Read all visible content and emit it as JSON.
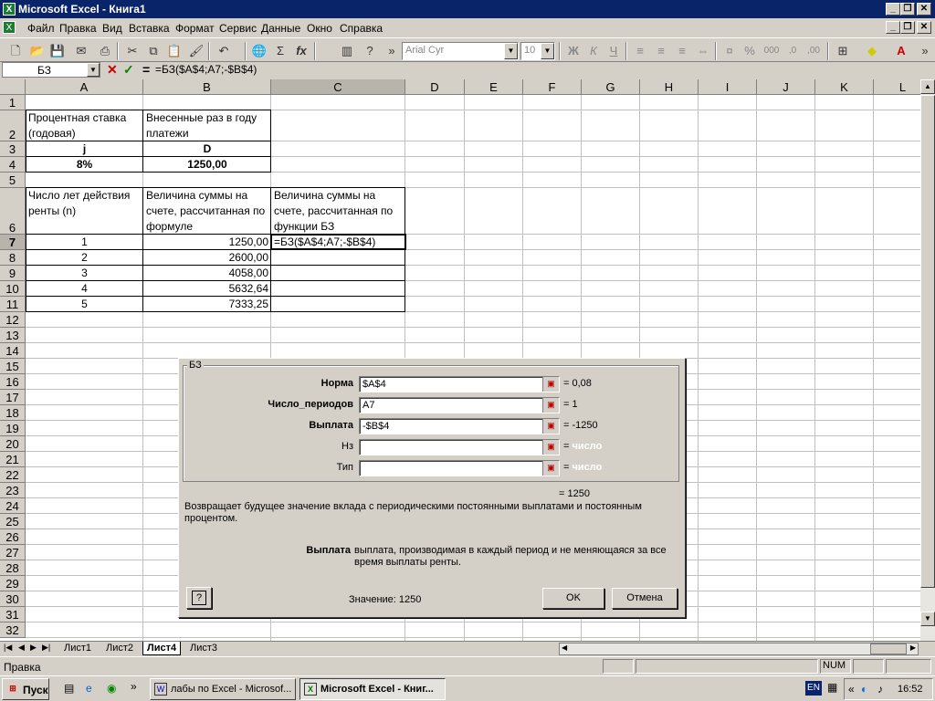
{
  "window": {
    "title": "Microsoft Excel - Книга1",
    "app_icon": "X"
  },
  "menu": [
    "Файл",
    "Правка",
    "Вид",
    "Вставка",
    "Формат",
    "Сервис",
    "Данные",
    "Окно",
    "Справка"
  ],
  "toolbar": {
    "font_name": "Arial Cyr",
    "font_size": "10"
  },
  "formula_bar": {
    "name_box": "БЗ",
    "equals": "=",
    "formula": "=БЗ($A$4;A7;-$B$4)"
  },
  "columns": [
    "A",
    "B",
    "C",
    "D",
    "E",
    "F",
    "G",
    "H",
    "I",
    "J",
    "K",
    "L"
  ],
  "rows": [
    "1",
    "2",
    "3",
    "4",
    "5",
    "6",
    "7",
    "8",
    "9",
    "10",
    "11",
    "12",
    "13",
    "14",
    "15",
    "16",
    "17",
    "18",
    "19",
    "20",
    "21",
    "22",
    "23",
    "24",
    "25",
    "26",
    "27",
    "28",
    "29",
    "30",
    "31",
    "32"
  ],
  "cells": {
    "A2": "Процентная ставка (годовая)",
    "B2": "Внесенные раз в году платежи",
    "A3": "j",
    "B3": "D",
    "A4": "8%",
    "B4": "1250,00",
    "A6": "Число лет действия ренты (n)",
    "B6": "Величина суммы на счете, рассчитанная по формуле",
    "C6": "Величина суммы на счете, рассчитанная по функции БЗ",
    "C7": "=БЗ($A$4;A7;-$B$4)",
    "A7": "1",
    "A8": "2",
    "A9": "3",
    "A10": "4",
    "A11": "5",
    "B7": "1250,00",
    "B8": "2600,00",
    "B9": "4058,00",
    "B10": "5632,64",
    "B11": "7333,25"
  },
  "sheet_tabs": [
    "Лист1",
    "Лист2",
    "Лист4",
    "Лист3"
  ],
  "active_tab": "Лист4",
  "status": {
    "mode": "Правка",
    "num": "NUM"
  },
  "dialog": {
    "title": "БЗ",
    "fields": [
      {
        "label": "Норма",
        "value": "$A$4",
        "result": "= 0,08"
      },
      {
        "label": "Число_периодов",
        "value": "A7",
        "result": "= 1"
      },
      {
        "label": "Выплата",
        "value": "-$B$4",
        "result": "= -1250"
      },
      {
        "label": "Нз",
        "value": "",
        "result": "= число"
      },
      {
        "label": "Тип",
        "value": "",
        "result": "= число"
      }
    ],
    "total": "= 1250",
    "description": "Возвращает будущее значение вклада  с периодическими постоянными выплатами и постоянным процентом.",
    "arg_name": "Выплата",
    "arg_desc": "выплата, производимая в каждый период и не меняющаяся за все время выплаты ренты.",
    "value_label": "Значение:",
    "value": "1250",
    "ok": "OK",
    "cancel": "Отмена"
  },
  "taskbar": {
    "start": "Пуск",
    "tasks": [
      "лабы по Excel - Microsof...",
      "Microsoft Excel - Книг..."
    ],
    "lang": "EN",
    "time": "16:52"
  }
}
